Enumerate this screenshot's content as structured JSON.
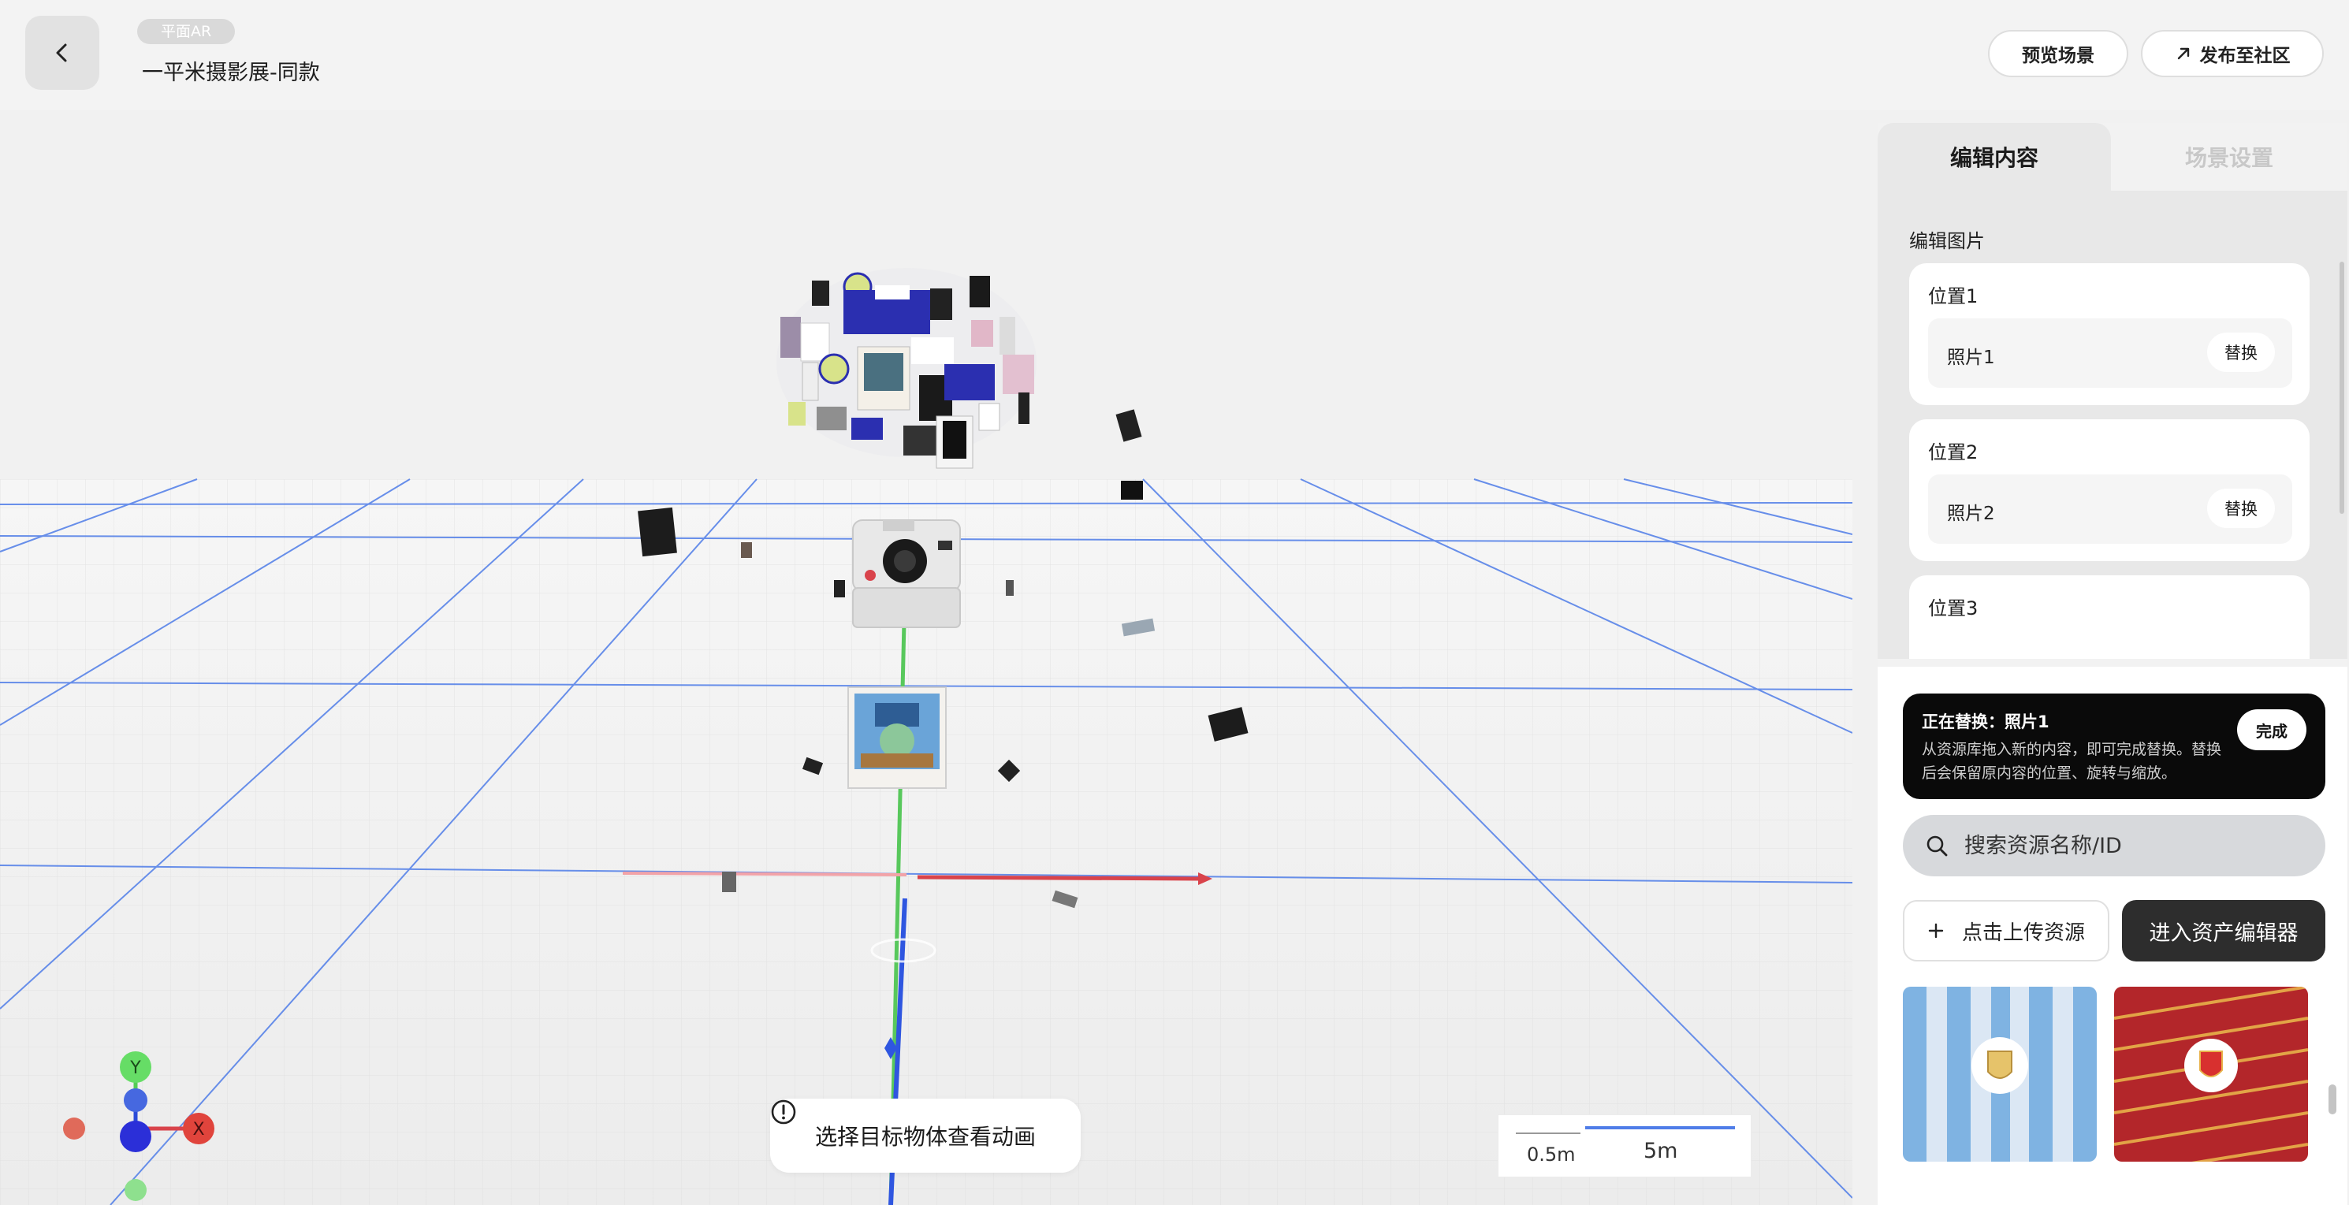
{
  "header": {
    "back_icon": "chevron-left-icon",
    "tag": "平面AR",
    "title": "一平米摄影展-同款",
    "preview_label": "预览场景",
    "publish_label": "发布至社区",
    "publish_icon": "arrow-up-right-icon"
  },
  "viewport": {
    "hint_label": "选择目标物体查看动画",
    "hint_icon": "exclamation-circle-icon",
    "scale_small": "0.5m",
    "scale_large": "5m",
    "axis_labels": {
      "x": "X",
      "y": "Y"
    },
    "colors": {
      "grid": "#4f7de8",
      "x_axis": "#d9434b",
      "y_axis": "#55cc55",
      "z_axis": "#2b4bd8"
    }
  },
  "panel": {
    "tabs": [
      {
        "label": "编辑内容",
        "active": true
      },
      {
        "label": "场景设置",
        "active": false
      }
    ],
    "section_label": "编辑图片",
    "positions": [
      {
        "title": "位置1",
        "photo": "照片1",
        "action": "替换"
      },
      {
        "title": "位置2",
        "photo": "照片2",
        "action": "替换"
      },
      {
        "title": "位置3",
        "photo": "",
        "action": ""
      }
    ],
    "notice": {
      "title": "正在替换：照片1",
      "description": "从资源库拖入新的内容，即可完成替换。替换后会保留原内容的位置、旋转与缩放。",
      "done_label": "完成"
    },
    "search": {
      "placeholder": "搜索资源名称/ID",
      "icon": "search-icon"
    },
    "upload_label": "点击上传资源",
    "upload_icon": "plus-icon",
    "editor_label": "进入资产编辑器",
    "thumbnails": [
      {
        "name": "argentina-jersey-thumbnail",
        "colors": [
          "#8fc0ea",
          "#ffffff"
        ]
      },
      {
        "name": "spain-jersey-thumbnail",
        "colors": [
          "#b3262a",
          "#e8b24a"
        ]
      }
    ]
  }
}
